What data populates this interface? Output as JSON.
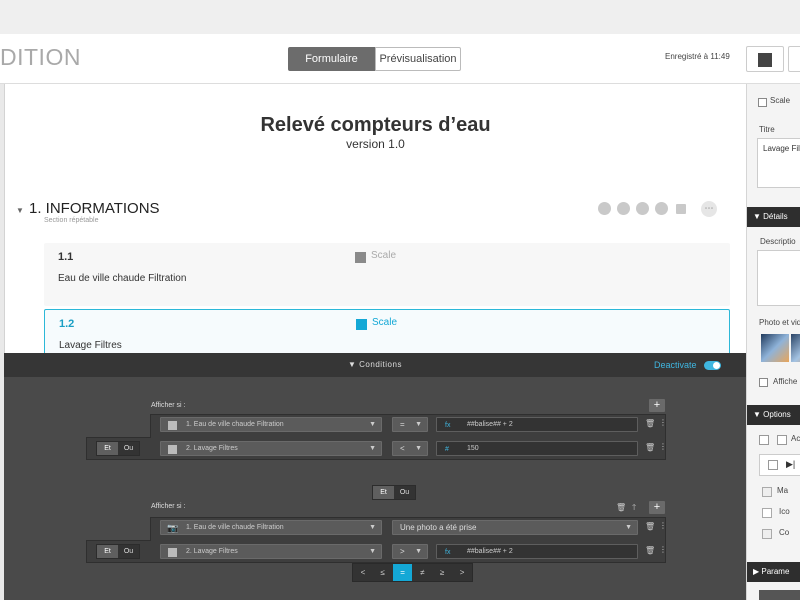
{
  "app": {
    "brand_fragment": "DITION",
    "tabs": [
      "Formulaire",
      "Prévisualisation"
    ],
    "saved_status": "Enregistré à 11:49"
  },
  "form": {
    "title": "Relevé compteurs d’eau",
    "version": "version 1.0",
    "section": {
      "title": "1. INFORMATIONS",
      "subtitle": "Section répétable"
    },
    "questions": [
      {
        "number": "1.1",
        "type": "Scale",
        "label": "Eau de ville chaude Filtration"
      },
      {
        "number": "1.2",
        "type": "Scale",
        "label": "Lavage Filtres",
        "selected": true
      }
    ]
  },
  "right_panel": {
    "scale_label": "Scale",
    "title_label": "Titre",
    "title_value": "Lavage Filt",
    "details_header": "Détails",
    "description_label": "Descriptio",
    "photo_label": "Photo et vid",
    "afficher_label": "Affiche",
    "options_header": "Options",
    "option_items": [
      "Ac",
      "Ma",
      "Ico",
      "Co"
    ],
    "param_header": "Parame"
  },
  "conditions": {
    "title": "Conditions",
    "deactivate_label": "Deactivate",
    "group1": {
      "show_if": "Afficher si :",
      "rows": [
        {
          "field": "1. Eau de ville chaude Filtration",
          "operator": "=",
          "value_type": "fx",
          "value": "##balise## + 2"
        },
        {
          "connector": "Et",
          "alt_connector": "Ou",
          "field": "2. Lavage Filtres",
          "operator": "<",
          "value_type": "#",
          "value": "150"
        }
      ]
    },
    "group_connector": {
      "et": "Et",
      "ou": "Ou"
    },
    "group2": {
      "show_if": "Afficher si :",
      "rows": [
        {
          "field": "1. Eau de ville chaude Filtration",
          "operator_value": "Une photo a été prise"
        },
        {
          "connector": "Et",
          "alt_connector": "Ou",
          "field": "2. Lavage Filtres",
          "operator": ">",
          "value_type": "fx",
          "value": "##balise## + 2"
        }
      ]
    },
    "comparators": [
      "<",
      "≤",
      "=",
      "≠",
      "≥",
      ">"
    ],
    "active_comparator": "="
  },
  "colors": {
    "accent": "#14a8d6",
    "panel_dark": "#4a4a4a",
    "header_dark": "#363636"
  }
}
